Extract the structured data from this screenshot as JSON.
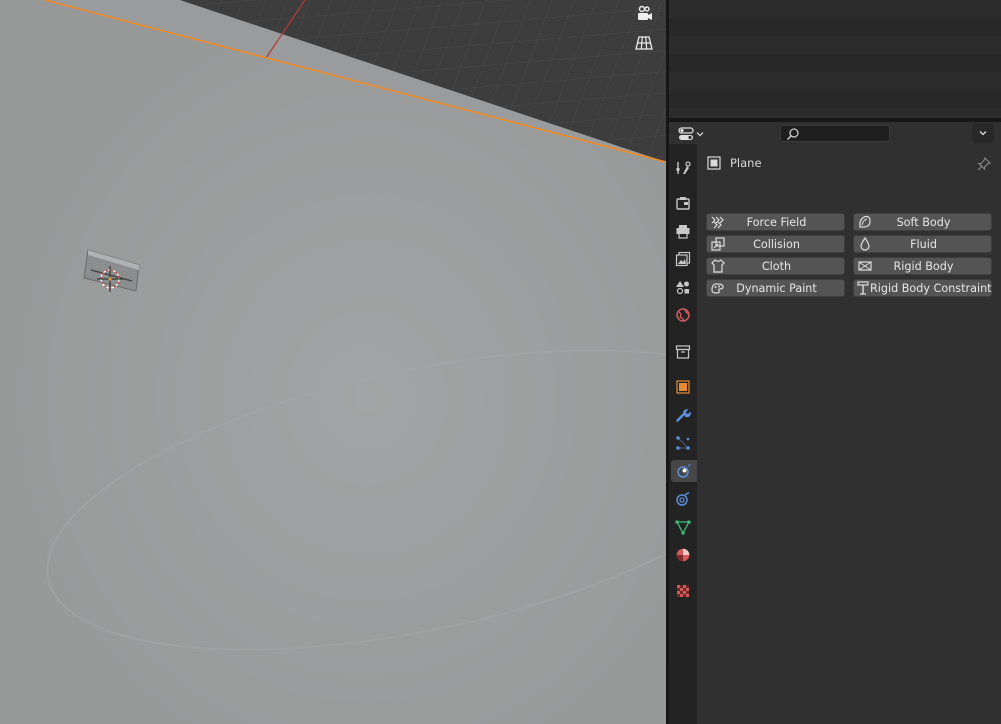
{
  "viewport": {
    "tools": [
      {
        "icon": "camera-view-icon"
      },
      {
        "icon": "grid-view-icon"
      }
    ],
    "object": {
      "name": "camera-object"
    }
  },
  "properties": {
    "header": {
      "editor_type_icon": "properties-editor-icon",
      "search": {
        "placeholder": "",
        "value": ""
      },
      "options_icon": "chevron-down-icon"
    },
    "tabs": [
      {
        "id": "tool",
        "icon": "tool-icon",
        "color": "#c8c8c8",
        "active": false
      },
      {
        "id": "render",
        "icon": "render-icon",
        "color": "#c8c8c8",
        "active": false
      },
      {
        "id": "output",
        "icon": "output-icon",
        "color": "#c8c8c8",
        "active": false
      },
      {
        "id": "view-layer",
        "icon": "view-layer-icon",
        "color": "#c8c8c8",
        "active": false
      },
      {
        "id": "scene",
        "icon": "scene-icon",
        "color": "#c8c8c8",
        "active": false
      },
      {
        "id": "world",
        "icon": "world-icon",
        "color": "#d25a5a",
        "active": false
      },
      {
        "id": "collection",
        "icon": "collection-icon",
        "color": "#c8c8c8",
        "active": false
      },
      {
        "id": "object",
        "icon": "object-icon",
        "color": "#e78a35",
        "active": false
      },
      {
        "id": "modifiers",
        "icon": "wrench-icon",
        "color": "#5b8ed8",
        "active": false
      },
      {
        "id": "particles",
        "icon": "particles-icon",
        "color": "#5b8ed8",
        "active": false
      },
      {
        "id": "physics",
        "icon": "physics-icon",
        "color": "#5b8ed8",
        "active": true
      },
      {
        "id": "constraints",
        "icon": "constraints-icon",
        "color": "#5b8ed8",
        "active": false
      },
      {
        "id": "data",
        "icon": "mesh-data-icon",
        "color": "#3fbf7a",
        "active": false
      },
      {
        "id": "material",
        "icon": "material-icon",
        "color": "#d25a5a",
        "active": false
      },
      {
        "id": "texture",
        "icon": "texture-icon",
        "color": "#d25a5a",
        "active": false
      }
    ],
    "context": {
      "object_name": "Plane",
      "object_icon": "mesh-object-icon",
      "pin_icon": "pin-icon"
    },
    "physics_buttons": {
      "left": [
        {
          "label": "Force Field",
          "icon": "force-field-icon"
        },
        {
          "label": "Collision",
          "icon": "collision-icon"
        },
        {
          "label": "Cloth",
          "icon": "cloth-icon"
        },
        {
          "label": "Dynamic Paint",
          "icon": "dynamic-paint-icon"
        }
      ],
      "right": [
        {
          "label": "Soft Body",
          "icon": "soft-body-icon"
        },
        {
          "label": "Fluid",
          "icon": "fluid-icon"
        },
        {
          "label": "Rigid Body",
          "icon": "rigid-body-icon"
        },
        {
          "label": "Rigid Body Constraint",
          "icon": "rigid-body-constraint-icon"
        }
      ]
    },
    "colors": {
      "accent_orange": "#e78a35",
      "axis_red": "#c43a3a",
      "physics_blue": "#5b8ed8"
    }
  }
}
